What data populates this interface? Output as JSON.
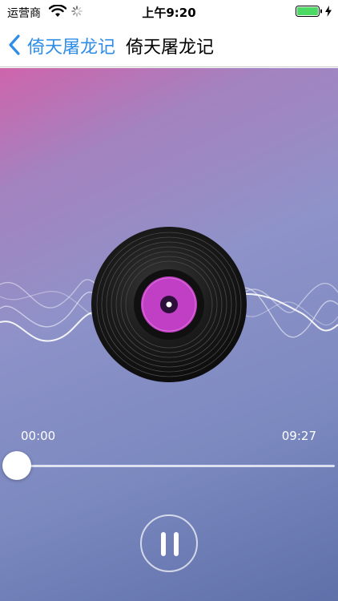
{
  "status_bar": {
    "carrier": "运营商",
    "time": "上午9:20",
    "icons": [
      "wifi-icon",
      "activity-spinner-icon",
      "battery-icon",
      "charging-icon"
    ],
    "battery_level": 1.0,
    "battery_color": "#4cd964"
  },
  "nav": {
    "back_label": "倚天屠龙记",
    "title": "倚天屠龙记",
    "accent_color": "#2d8ce6"
  },
  "player": {
    "current_time": "00:00",
    "total_time": "09:27",
    "progress": 0.0,
    "control_icon": "pause-icon",
    "disc_label_color": "#c03fc4"
  }
}
